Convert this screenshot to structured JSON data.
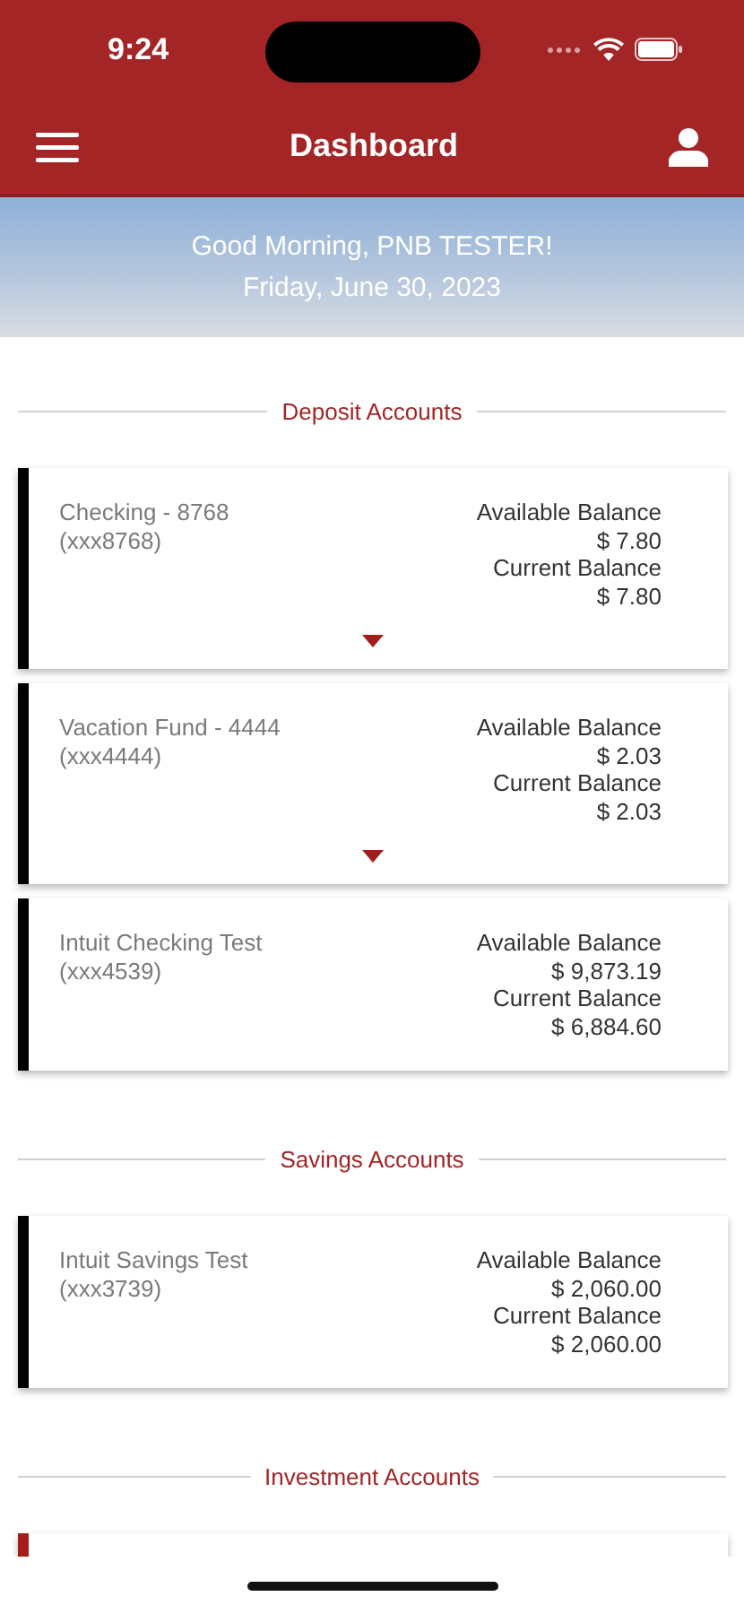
{
  "status_bar": {
    "time": "9:24"
  },
  "header": {
    "title": "Dashboard"
  },
  "banner": {
    "greeting": "Good Morning, PNB TESTER!",
    "date": "Friday, June 30, 2023"
  },
  "sections": [
    {
      "title": "Deposit Accounts",
      "accounts": [
        {
          "name": "Checking - 8768",
          "number": "(xxx8768)",
          "available_label": "Available Balance",
          "available": "$ 7.80",
          "current_label": "Current Balance",
          "current": "$ 7.80",
          "expandable": true,
          "color": "#000000"
        },
        {
          "name": "Vacation Fund - 4444",
          "number": "(xxx4444)",
          "available_label": "Available Balance",
          "available": "$ 2.03",
          "current_label": "Current Balance",
          "current": "$ 2.03",
          "expandable": true,
          "color": "#000000"
        },
        {
          "name": "Intuit Checking Test",
          "number": "(xxx4539)",
          "available_label": "Available Balance",
          "available": "$ 9,873.19",
          "current_label": "Current Balance",
          "current": "$ 6,884.60",
          "expandable": false,
          "color": "#000000"
        }
      ]
    },
    {
      "title": "Savings Accounts",
      "accounts": [
        {
          "name": "Intuit Savings Test",
          "number": "(xxx3739)",
          "available_label": "Available Balance",
          "available": "$ 2,060.00",
          "current_label": "Current Balance",
          "current": "$ 2,060.00",
          "expandable": false,
          "color": "#000000"
        }
      ]
    },
    {
      "title": "Investment Accounts",
      "accounts": [
        {
          "expandable": false,
          "color": "#a61c1c"
        }
      ]
    }
  ]
}
